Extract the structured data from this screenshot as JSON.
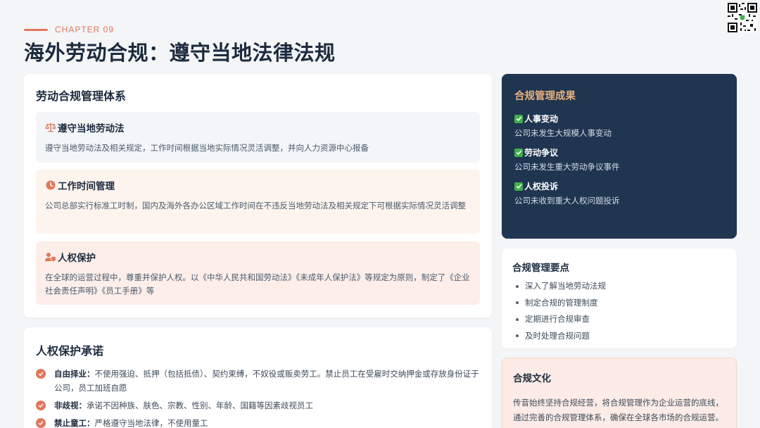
{
  "header": {
    "chapter": "CHAPTER 09",
    "title": "海外劳动合规：遵守当地法律法规"
  },
  "system": {
    "title": "劳动合规管理体系",
    "items": [
      {
        "icon": "scale-icon",
        "title": "遵守当地劳动法",
        "desc": "遵守当地劳动法及相关规定，工作时间根据当地实际情况灵活调整，并向人力资源中心报备"
      },
      {
        "icon": "clock-icon",
        "title": "工作时间管理",
        "desc": "公司总部实行标准工时制，国内及海外各办公区域工作时间在不违反当地劳动法及相关规定下可根据实际情况灵活调整"
      },
      {
        "icon": "user-shield-icon",
        "title": "人权保护",
        "desc": "在全球的运营过程中，尊重并保护人权。以《中华人民共和国劳动法》《未成年人保护法》等规定为原则，制定了《企业社会责任声明》《员工手册》等"
      }
    ]
  },
  "commitments": {
    "title": "人权保护承诺",
    "items": [
      {
        "label": "自由择业：",
        "text": "不使用强迫、抵押（包括抵债）、契约束缚，不奴役或贩卖劳工。禁止员工在受雇时交纳押金或存放身份证于公司，员工加班自愿"
      },
      {
        "label": "非歧视：",
        "text": "承诺不因种族、肤色、宗教、性别、年龄、国籍等因素歧视员工"
      },
      {
        "label": "禁止童工：",
        "text": "严格遵守当地法律，不使用童工"
      }
    ]
  },
  "results": {
    "title": "合规管理成果",
    "items": [
      {
        "title": "人事变动",
        "desc": "公司未发生大规模人事变动"
      },
      {
        "title": "劳动争议",
        "desc": "公司未发生重大劳动争议事件"
      },
      {
        "title": "人权投诉",
        "desc": "公司未收到重大人权问题投诉"
      }
    ]
  },
  "key_points": {
    "title": "合规管理要点",
    "items": [
      "深入了解当地劳动法规",
      "制定合规的管理制度",
      "定期进行合规审查",
      "及时处理合规问题"
    ]
  },
  "culture": {
    "title": "合规文化",
    "text": "传音始终坚持合规经营，将合规管理作为企业运营的底线，通过完善的合规管理体系，确保在全球各市场的合规运营。"
  },
  "colors": {
    "accent": "#e0775a",
    "navy": "#1f3550",
    "gold": "#e8b27c",
    "check_green": "#3fb04a"
  }
}
